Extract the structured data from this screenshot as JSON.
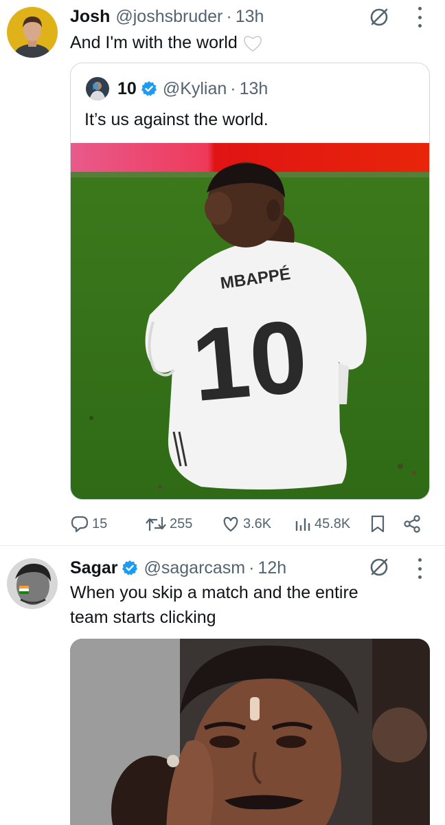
{
  "tweets": [
    {
      "name": "Josh",
      "handle": "@joshsbruder",
      "separator": "·",
      "time": "13h",
      "text": "And I'm with the world",
      "emoji": "🤍",
      "quote": {
        "name": "10",
        "handle": "@Kylian",
        "separator": "·",
        "time": "13h",
        "text": "It’s us against the world.",
        "jersey_name": "MBAPPÉ",
        "jersey_number": "10"
      },
      "actions": {
        "replies": "15",
        "retweets": "255",
        "likes": "3.6K",
        "views": "45.8K"
      }
    },
    {
      "name": "Sagar",
      "handle": "@sagarcasm",
      "separator": "·",
      "time": "12h",
      "text_line1": "When you skip a match and the entire",
      "text_line2": "team starts clicking"
    }
  ],
  "icons": {
    "grok": "grok-icon",
    "more": "more-options-icon",
    "verified": "verified-badge-icon",
    "reply": "reply-icon",
    "retweet": "retweet-icon",
    "like": "like-icon",
    "views": "views-icon",
    "bookmark": "bookmark-icon",
    "share": "share-icon"
  },
  "colors": {
    "verified": "#1d9bf0",
    "secondary_text": "#536471",
    "primary_text": "#0f1419"
  }
}
